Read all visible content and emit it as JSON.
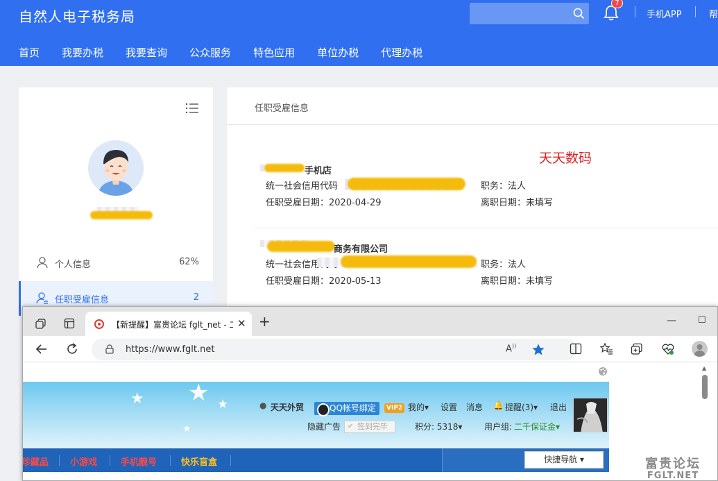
{
  "header": {
    "title": "自然人电子税务局",
    "notification_count": "7",
    "app_link": "手机APP",
    "help_link": "帮",
    "nav": [
      "首页",
      "我要办税",
      "我要查询",
      "公众服务",
      "特色应用",
      "单位办税",
      "代理办税"
    ]
  },
  "sidebar": {
    "items": [
      {
        "label": "个人信息",
        "value": "62%"
      },
      {
        "label": "任职受雇信息",
        "value": "2"
      }
    ]
  },
  "main": {
    "title": "任职受雇信息",
    "watermark": "天天数码",
    "records": [
      {
        "name": "手机店",
        "code_label": "统一社会信用代码",
        "position": "职务：法人",
        "start_date": "任职受雇日期：2020-04-29",
        "end_date": "离职日期：未填写"
      },
      {
        "name": "商务有限公司",
        "code_label": "统一社会信用代码",
        "position": "职务：法人",
        "start_date": "任职受雇日期：2020-05-13",
        "end_date": "离职日期：未填写"
      }
    ]
  },
  "browser": {
    "tab_title": "【新提醒】富贵论坛 fglt_net - 二",
    "url": "https://www.fglt.net",
    "forum": {
      "username": "天天外贸",
      "qq_bind": "QQ帐号绑定",
      "vip_badge": "VIP2",
      "my": "我的",
      "settings": "设置",
      "messages": "消息",
      "reminder": "提醒(3)",
      "logout": "退出",
      "hide_ads": "隐藏广告",
      "sign_done": "签到完毕",
      "points": "积分: 5318",
      "usergroup_label": "用户组:",
      "usergroup": "二千保证金",
      "nav_links": [
        "珍藏品",
        "小游戏",
        "手机靓号",
        "快乐盲盒"
      ],
      "quick_nav": "快捷导航"
    }
  },
  "watermark_site": {
    "name": "富贵论坛",
    "domain": "FGLT.NET"
  }
}
